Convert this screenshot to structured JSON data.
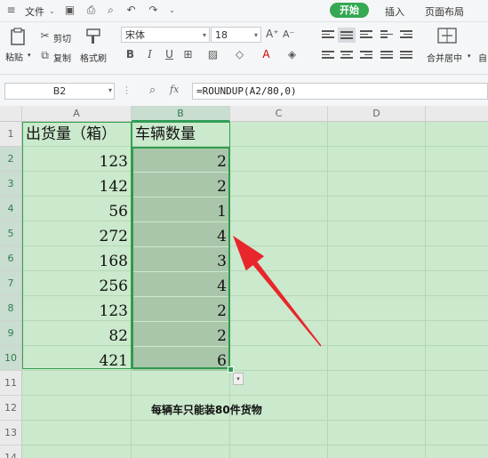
{
  "menubar": {
    "file_label": "文件",
    "tabs": [
      "开始",
      "插入",
      "页面布局"
    ]
  },
  "ribbon": {
    "paste_label": "粘贴",
    "cut_label": "剪切",
    "copy_label": "复制",
    "format_painter_label": "格式刷",
    "font_name": "宋体",
    "font_size": "18",
    "merge_label": "合并居中",
    "auto_label": "自"
  },
  "formula_bar": {
    "cell_ref": "B2",
    "fx_label": "fx",
    "formula": "=ROUNDUP(A2/80,0)"
  },
  "sheet": {
    "columns": [
      "A",
      "B",
      "C",
      "D"
    ],
    "rows": [
      "1",
      "2",
      "3",
      "4",
      "5",
      "6",
      "7",
      "8",
      "9",
      "10",
      "11",
      "12",
      "13",
      "14"
    ],
    "header_a": "出货量（箱）",
    "header_b": "车辆数量",
    "values_a": [
      "123",
      "142",
      "56",
      "272",
      "168",
      "256",
      "123",
      "82",
      "421"
    ],
    "values_b": [
      "2",
      "2",
      "1",
      "4",
      "3",
      "4",
      "2",
      "2",
      "6"
    ],
    "note": "每辆车只能装80件货物",
    "accent_color": "#34a853",
    "arrow_color": "#e8262b"
  }
}
